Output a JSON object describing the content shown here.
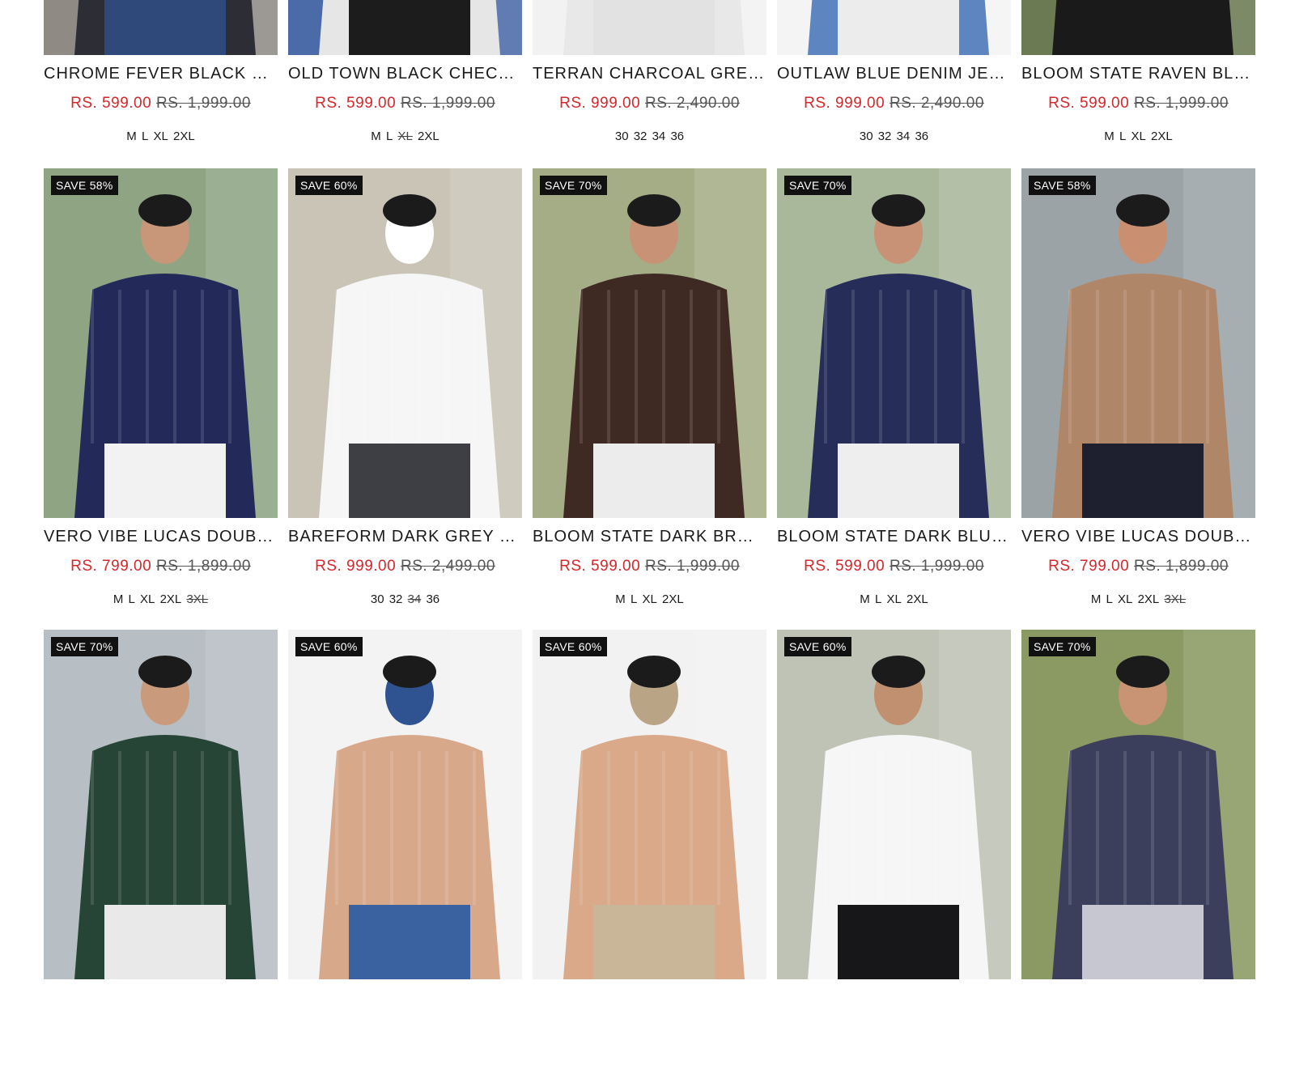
{
  "products": [
    {
      "title": "CHROME FEVER BLACK C…",
      "price": "RS. 599.00",
      "compare": "RS. 1,999.00",
      "badge": "",
      "sizes": [
        {
          "l": "M",
          "out": false
        },
        {
          "l": "L",
          "out": false
        },
        {
          "l": "XL",
          "out": false
        },
        {
          "l": "2XL",
          "out": false
        }
      ],
      "colors": {
        "bg": "#8f8a84",
        "top": "#2d2d35",
        "bottom": "#2f4a7a",
        "accent": "#d9d9d9"
      }
    },
    {
      "title": "OLD TOWN BLACK CHECK…",
      "price": "RS. 599.00",
      "compare": "RS. 1,999.00",
      "badge": "",
      "sizes": [
        {
          "l": "M",
          "out": false
        },
        {
          "l": "L",
          "out": false
        },
        {
          "l": "XL",
          "out": true
        },
        {
          "l": "2XL",
          "out": false
        }
      ],
      "colors": {
        "bg": "#4a6aa8",
        "top": "#e6e6e6",
        "bottom": "#1c1c1c",
        "accent": "#222"
      }
    },
    {
      "title": "TERRAN CHARCOAL GRE…",
      "price": "RS. 999.00",
      "compare": "RS. 2,490.00",
      "badge": "",
      "sizes": [
        {
          "l": "30",
          "out": false
        },
        {
          "l": "32",
          "out": false
        },
        {
          "l": "34",
          "out": false
        },
        {
          "l": "36",
          "out": false
        }
      ],
      "colors": {
        "bg": "#f2f2f2",
        "top": "#e8e8e8",
        "bottom": "#e2e2e2",
        "accent": "#bdbdbd"
      }
    },
    {
      "title": "OUTLAW BLUE DENIM JEA…",
      "price": "RS. 999.00",
      "compare": "RS. 2,490.00",
      "badge": "",
      "sizes": [
        {
          "l": "30",
          "out": false
        },
        {
          "l": "32",
          "out": false
        },
        {
          "l": "34",
          "out": false
        },
        {
          "l": "36",
          "out": false
        }
      ],
      "colors": {
        "bg": "#f4f4f4",
        "top": "#5d86c0",
        "bottom": "#ececec",
        "accent": "#bcbcbc"
      }
    },
    {
      "title": "BLOOM STATE RAVEN BLA…",
      "price": "RS. 599.00",
      "compare": "RS. 1,999.00",
      "badge": "",
      "sizes": [
        {
          "l": "M",
          "out": false
        },
        {
          "l": "L",
          "out": false
        },
        {
          "l": "XL",
          "out": false
        },
        {
          "l": "2XL",
          "out": false
        }
      ],
      "colors": {
        "bg": "#6b7a52",
        "top": "#1a1a1a",
        "bottom": "#1a1a1a",
        "accent": "#d8d8d8"
      }
    },
    {
      "title": "VERO VIBE LUCAS DOUBL…",
      "price": "RS. 799.00",
      "compare": "RS. 1,899.00",
      "badge": "SAVE 58%",
      "sizes": [
        {
          "l": "M",
          "out": false
        },
        {
          "l": "L",
          "out": false
        },
        {
          "l": "XL",
          "out": false
        },
        {
          "l": "2XL",
          "out": false
        },
        {
          "l": "3XL",
          "out": true
        }
      ],
      "colors": {
        "bg": "#8ea483",
        "top": "#232a5a",
        "bottom": "#f2f2f2",
        "accent": "#c89678"
      }
    },
    {
      "title": "BAREFORM DARK GREY C…",
      "price": "RS. 999.00",
      "compare": "RS. 2,499.00",
      "badge": "SAVE 60%",
      "sizes": [
        {
          "l": "30",
          "out": false
        },
        {
          "l": "32",
          "out": false
        },
        {
          "l": "34",
          "out": true
        },
        {
          "l": "36",
          "out": false
        }
      ],
      "colors": {
        "bg": "#c9c4b6",
        "top": "#f6f6f6",
        "bottom": "#3e3f44",
        "accent": "#ffffff"
      }
    },
    {
      "title": "BLOOM STATE DARK BRO…",
      "price": "RS. 599.00",
      "compare": "RS. 1,999.00",
      "badge": "SAVE 70%",
      "sizes": [
        {
          "l": "M",
          "out": false
        },
        {
          "l": "L",
          "out": false
        },
        {
          "l": "XL",
          "out": false
        },
        {
          "l": "2XL",
          "out": false
        }
      ],
      "colors": {
        "bg": "#a4ad86",
        "top": "#3e2a22",
        "bottom": "#ececec",
        "accent": "#c79275"
      }
    },
    {
      "title": "BLOOM STATE DARK BLUE…",
      "price": "RS. 599.00",
      "compare": "RS. 1,999.00",
      "badge": "SAVE 70%",
      "sizes": [
        {
          "l": "M",
          "out": false
        },
        {
          "l": "L",
          "out": false
        },
        {
          "l": "XL",
          "out": false
        },
        {
          "l": "2XL",
          "out": false
        }
      ],
      "colors": {
        "bg": "#a9b79a",
        "top": "#262d58",
        "bottom": "#eeeeee",
        "accent": "#c79275"
      }
    },
    {
      "title": "VERO VIBE LUCAS DOUBL…",
      "price": "RS. 799.00",
      "compare": "RS. 1,899.00",
      "badge": "SAVE 58%",
      "sizes": [
        {
          "l": "M",
          "out": false
        },
        {
          "l": "L",
          "out": false
        },
        {
          "l": "XL",
          "out": false
        },
        {
          "l": "2XL",
          "out": false
        },
        {
          "l": "3XL",
          "out": true
        }
      ],
      "colors": {
        "bg": "#9ba3a7",
        "top": "#b08668",
        "bottom": "#1e2030",
        "accent": "#c89070"
      }
    },
    {
      "title": "",
      "price": "",
      "compare": "",
      "badge": "SAVE 70%",
      "sizes": [],
      "colors": {
        "bg": "#b7bec4",
        "top": "#274536",
        "bottom": "#e9e9e9",
        "accent": "#c99a7c"
      }
    },
    {
      "title": "",
      "price": "",
      "compare": "",
      "badge": "SAVE 60%",
      "sizes": [],
      "colors": {
        "bg": "#f3f3f3",
        "top": "#d8a88a",
        "bottom": "#3a62a0",
        "accent": "#2f5390"
      }
    },
    {
      "title": "",
      "price": "",
      "compare": "",
      "badge": "SAVE 60%",
      "sizes": [],
      "colors": {
        "bg": "#f2f2f2",
        "top": "#d9a98a",
        "bottom": "#c9b597",
        "accent": "#b9a585"
      }
    },
    {
      "title": "",
      "price": "",
      "compare": "",
      "badge": "SAVE 60%",
      "sizes": [],
      "colors": {
        "bg": "#bfc3b6",
        "top": "#f6f6f6",
        "bottom": "#17171a",
        "accent": "#c09070"
      }
    },
    {
      "title": "",
      "price": "",
      "compare": "",
      "badge": "SAVE 70%",
      "sizes": [],
      "colors": {
        "bg": "#8a9a62",
        "top": "#3b3f5c",
        "bottom": "#c7c7d2",
        "accent": "#c89474"
      }
    }
  ]
}
